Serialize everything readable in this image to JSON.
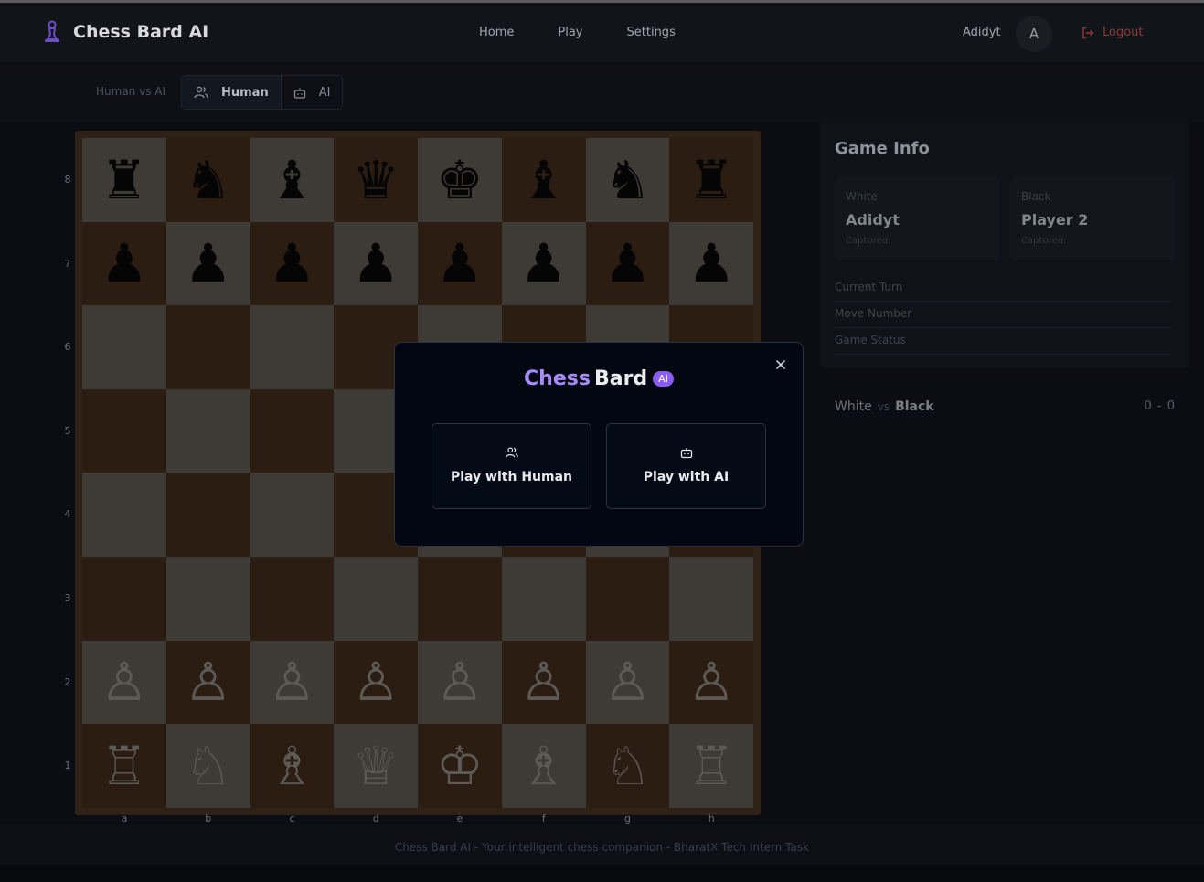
{
  "header": {
    "brand": "Chess Bard AI",
    "nav": [
      "Home",
      "Play",
      "Settings"
    ],
    "user_name": "Adidyt",
    "avatar_initial": "A",
    "logout_label": "Logout"
  },
  "mode_bar": {
    "label": "Human vs AI",
    "options": [
      "Human",
      "AI"
    ],
    "selected": "Human"
  },
  "board": {
    "ranks": [
      "8",
      "7",
      "6",
      "5",
      "4",
      "3",
      "2",
      "1"
    ],
    "files": [
      "a",
      "b",
      "c",
      "d",
      "e",
      "f",
      "g",
      "h"
    ],
    "position": [
      [
        "♜",
        "♞",
        "♝",
        "♛",
        "♚",
        "♝",
        "♞",
        "♜"
      ],
      [
        "♟",
        "♟",
        "♟",
        "♟",
        "♟",
        "♟",
        "♟",
        "♟"
      ],
      [
        "",
        "",
        "",
        "",
        "",
        "",
        "",
        ""
      ],
      [
        "",
        "",
        "",
        "",
        "",
        "",
        "",
        ""
      ],
      [
        "",
        "",
        "",
        "",
        "",
        "",
        "",
        ""
      ],
      [
        "",
        "",
        "",
        "",
        "",
        "",
        "",
        ""
      ],
      [
        "♙",
        "♙",
        "♙",
        "♙",
        "♙",
        "♙",
        "♙",
        "♙"
      ],
      [
        "♖",
        "♘",
        "♗",
        "♕",
        "♔",
        "♗",
        "♘",
        "♖"
      ]
    ]
  },
  "game_info": {
    "title": "Game Info",
    "white": {
      "label": "White",
      "name": "Adidyt",
      "captured_label": "Captured:"
    },
    "black": {
      "label": "Black",
      "name": "Player 2",
      "captured_label": "Captured:"
    },
    "rows": [
      "Current Turn",
      "Move Number",
      "Game Status"
    ]
  },
  "score": {
    "white": "White",
    "vs": "vs",
    "black": "Black",
    "value": "0 - 0"
  },
  "footer": {
    "text": "Chess Bard AI - Your intelligent chess companion - BharatX Tech Intern Task"
  },
  "modal": {
    "title_part1": "Chess",
    "title_part2": "Bard",
    "badge": "AI",
    "options": [
      "Play with Human",
      "Play with AI"
    ]
  },
  "colors": {
    "accent": "#a78bfa",
    "badge": "#8b5cf6",
    "logout": "#8f3b3b",
    "light_square": "#3e3a35",
    "dark_square": "#2c1d12"
  }
}
